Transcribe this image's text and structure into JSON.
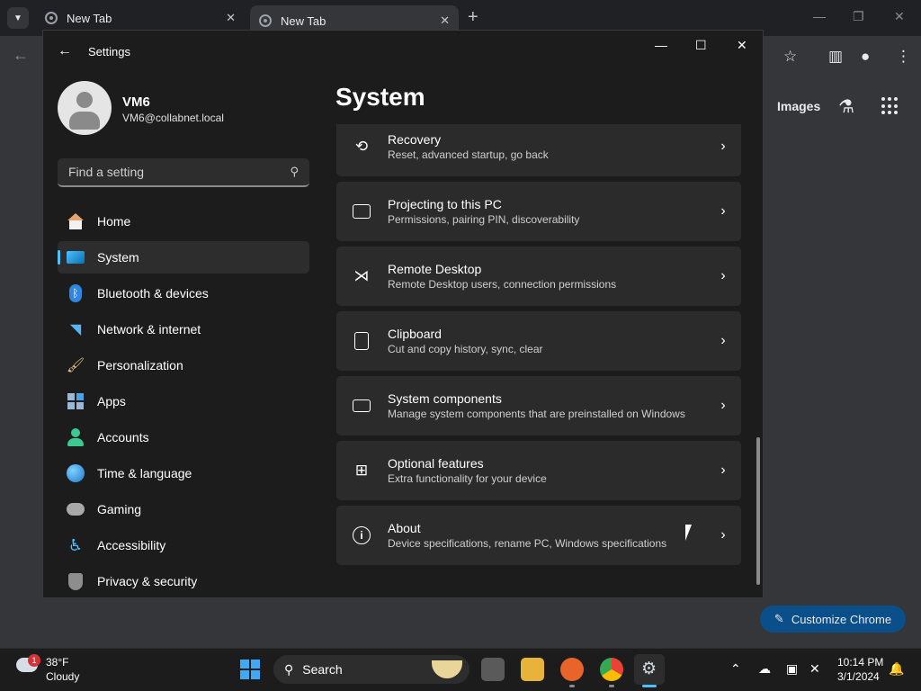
{
  "browser": {
    "tabs": [
      {
        "label": "New Tab",
        "close": "✕"
      },
      {
        "label": "New Tab",
        "close": "✕"
      }
    ],
    "new_tab": "+",
    "images_link": "Images",
    "customize_label": "Customize Chrome"
  },
  "settings": {
    "window_title": "Settings",
    "profile": {
      "name": "VM6",
      "email": "VM6@collabnet.local"
    },
    "search_placeholder": "Find a setting",
    "page_title": "System",
    "nav": [
      {
        "label": "Home",
        "icon": "home-icon"
      },
      {
        "label": "System",
        "icon": "system-icon",
        "selected": true
      },
      {
        "label": "Bluetooth & devices",
        "icon": "bluetooth-icon"
      },
      {
        "label": "Network & internet",
        "icon": "wifi-icon"
      },
      {
        "label": "Personalization",
        "icon": "brush-icon"
      },
      {
        "label": "Apps",
        "icon": "apps-icon"
      },
      {
        "label": "Accounts",
        "icon": "account-icon"
      },
      {
        "label": "Time & language",
        "icon": "globe-clock-icon"
      },
      {
        "label": "Gaming",
        "icon": "controller-icon"
      },
      {
        "label": "Accessibility",
        "icon": "accessibility-icon"
      },
      {
        "label": "Privacy & security",
        "icon": "shield-icon"
      }
    ],
    "cards": [
      {
        "title": "Recovery",
        "subtitle": "Reset, advanced startup, go back",
        "icon": "recovery-icon"
      },
      {
        "title": "Projecting to this PC",
        "subtitle": "Permissions, pairing PIN, discoverability",
        "icon": "projecting-icon"
      },
      {
        "title": "Remote Desktop",
        "subtitle": "Remote Desktop users, connection permissions",
        "icon": "remote-desktop-icon"
      },
      {
        "title": "Clipboard",
        "subtitle": "Cut and copy history, sync, clear",
        "icon": "clipboard-icon"
      },
      {
        "title": "System components",
        "subtitle": "Manage system components that are preinstalled on Windows",
        "icon": "system-components-icon"
      },
      {
        "title": "Optional features",
        "subtitle": "Extra functionality for your device",
        "icon": "optional-features-icon"
      },
      {
        "title": "About",
        "subtitle": "Device specifications, rename PC, Windows specifications",
        "icon": "info-icon"
      }
    ]
  },
  "taskbar": {
    "weather": {
      "temp": "38°F",
      "condition": "Cloudy",
      "badge": "1"
    },
    "search_label": "Search",
    "clock": {
      "time": "10:14 PM",
      "date": "3/1/2024"
    }
  },
  "colors": {
    "accent": "#4cc2ff",
    "card_bg": "#2b2b2b",
    "window_bg": "#1c1c1c",
    "customize_bg": "#0b4f8a"
  }
}
